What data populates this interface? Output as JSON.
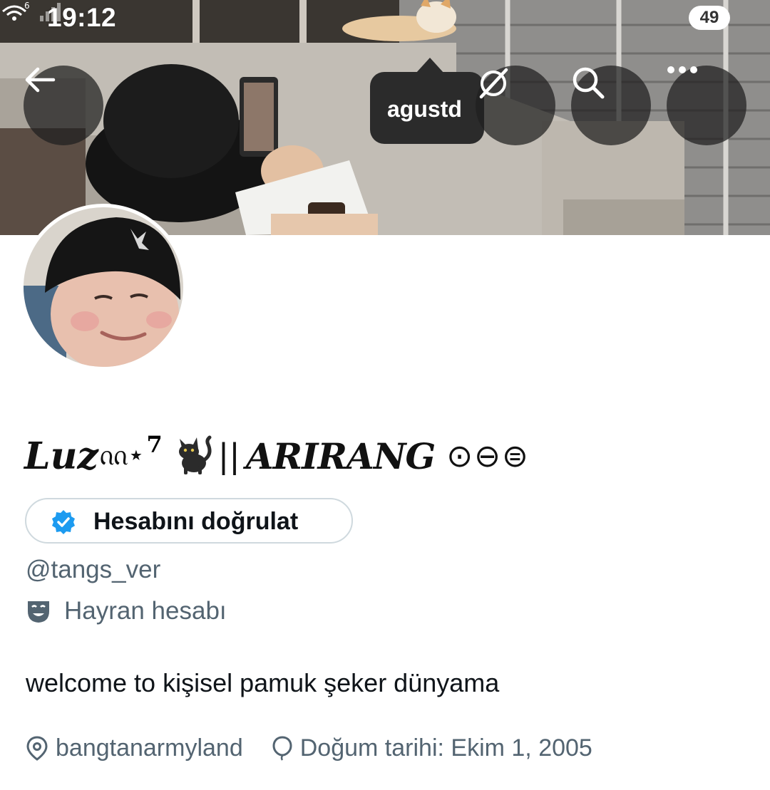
{
  "status_bar": {
    "time": "19:12",
    "wifi_badge": "6",
    "battery": "49"
  },
  "header": {
    "back_icon": "arrow-left-icon",
    "tooltip_label": "agustd",
    "grok_icon": "grok-icon",
    "search_icon": "search-icon",
    "more_icon": "more-horizontal-icon"
  },
  "profile": {
    "name_script": "Luz",
    "name_decor": "ᦶ⋆",
    "name_sup": "7",
    "name_cat_icon": "black-cat-emoji",
    "name_separator": "||",
    "name_arirang": "ARIRANG",
    "name_symbols": "⊙⊖⊜",
    "verify_label": "Hesabını doğrulat",
    "verify_badge_color": "#1d9bf0",
    "handle": "@tangs_ver",
    "category_icon": "theater-masks-icon",
    "category": "Hayran hesabı",
    "bio": "welcome to kişisel pamuk şeker dünyama",
    "location_icon": "location-pin-icon",
    "location": "bangtanarmyland",
    "birthday_icon": "balloon-icon",
    "birthday": "Doğum tarihi: Ekim 1, 2005"
  },
  "colors": {
    "primary_text": "#0f1419",
    "secondary_text": "#536471",
    "border": "#cfd9de",
    "accent": "#1d9bf0"
  }
}
